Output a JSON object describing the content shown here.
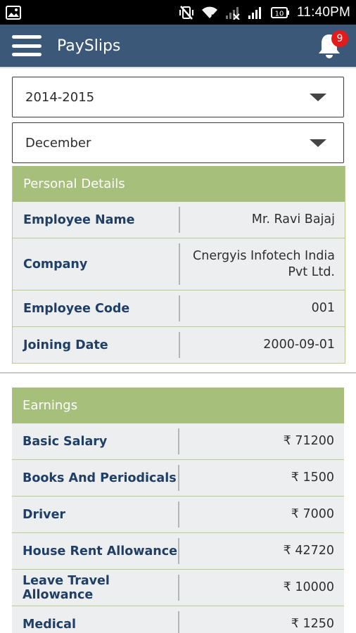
{
  "status_bar": {
    "time": "11:40PM",
    "battery": "10"
  },
  "app_bar": {
    "title": "PaySlips",
    "notification_count": "9"
  },
  "filters": {
    "year": "2014-2015",
    "month": "December"
  },
  "personal_details": {
    "header": "Personal Details",
    "rows": [
      {
        "label": "Employee Name",
        "value": "Mr. Ravi Bajaj"
      },
      {
        "label": "Company",
        "value": "Cnergyis Infotech India Pvt Ltd."
      },
      {
        "label": "Employee Code",
        "value": "001"
      },
      {
        "label": "Joining Date",
        "value": "2000-09-01"
      }
    ]
  },
  "earnings": {
    "header": "Earnings",
    "rows": [
      {
        "label": "Basic Salary",
        "value": "₹ 71200"
      },
      {
        "label": "Books And Periodicals",
        "value": "₹ 1500"
      },
      {
        "label": "Driver",
        "value": "₹ 7000"
      },
      {
        "label": "House Rent Allowance",
        "value": "₹ 42720"
      },
      {
        "label": "Leave Travel Allowance",
        "value": "₹ 10000"
      },
      {
        "label": "Medical",
        "value": "₹ 1250"
      }
    ]
  },
  "icons": {
    "menu": "hamburger-menu-icon",
    "notifications": "bell-icon",
    "dropdown": "triangle-down-icon"
  },
  "colors": {
    "app_bar": "#3b5878",
    "section_header": "#a6bf7b",
    "badge": "#e31b1b",
    "row_bg": "#eceeef",
    "label_text": "#1f3f66"
  }
}
